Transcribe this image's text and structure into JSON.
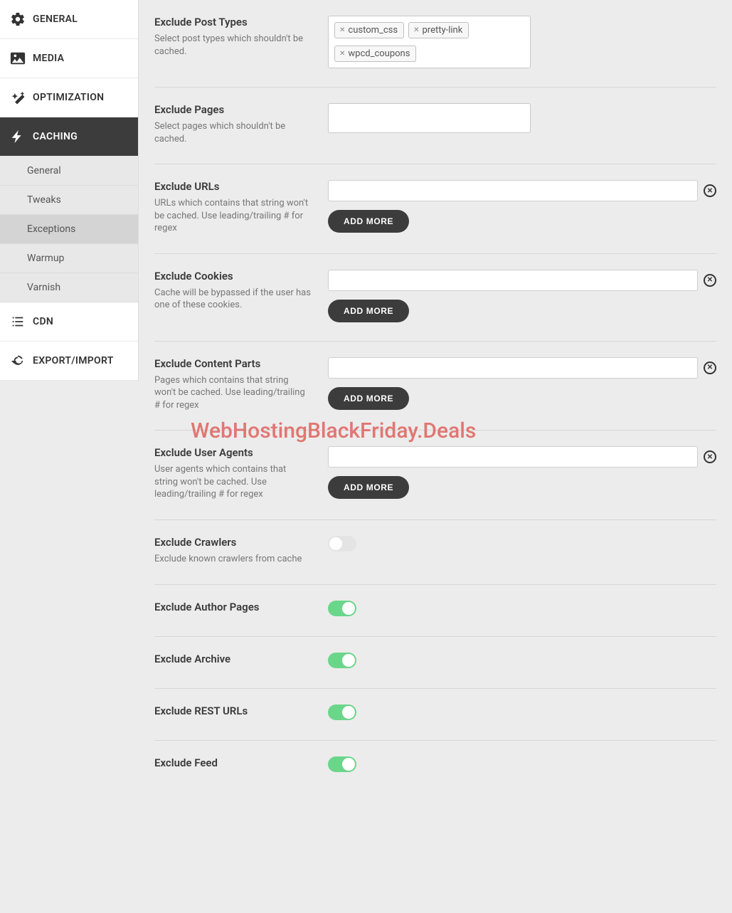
{
  "sidebar": {
    "items": [
      {
        "label": "GENERAL"
      },
      {
        "label": "MEDIA"
      },
      {
        "label": "OPTIMIZATION"
      },
      {
        "label": "CACHING"
      },
      {
        "label": "CDN"
      },
      {
        "label": "EXPORT/IMPORT"
      }
    ],
    "sub": [
      {
        "label": "General"
      },
      {
        "label": "Tweaks"
      },
      {
        "label": "Exceptions"
      },
      {
        "label": "Warmup"
      },
      {
        "label": "Varnish"
      }
    ]
  },
  "watermark": "WebHostingBlackFriday.Deals",
  "addmore_label": "ADD MORE",
  "rows": {
    "posttypes": {
      "title": "Exclude Post Types",
      "desc": "Select post types which shouldn't be cached.",
      "tokens": [
        "custom_css",
        "pretty-link",
        "wpcd_coupons"
      ]
    },
    "pages": {
      "title": "Exclude Pages",
      "desc": "Select pages which shouldn't be cached."
    },
    "urls": {
      "title": "Exclude URLs",
      "desc": "URLs which contains that string won't be cached. Use leading/trailing # for regex"
    },
    "cookies": {
      "title": "Exclude Cookies",
      "desc": "Cache will be bypassed if the user has one of these cookies."
    },
    "content": {
      "title": "Exclude Content Parts",
      "desc": "Pages which contains that string won't be cached. Use leading/trailing # for regex"
    },
    "ua": {
      "title": "Exclude User Agents",
      "desc": "User agents which contains that string won't be cached. Use leading/trailing # for regex"
    },
    "crawlers": {
      "title": "Exclude Crawlers",
      "desc": "Exclude known crawlers from cache",
      "on": false
    },
    "author": {
      "title": "Exclude Author Pages",
      "on": true
    },
    "archive": {
      "title": "Exclude Archive",
      "on": true
    },
    "rest": {
      "title": "Exclude REST URLs",
      "on": true
    },
    "feed": {
      "title": "Exclude Feed",
      "on": true
    }
  }
}
